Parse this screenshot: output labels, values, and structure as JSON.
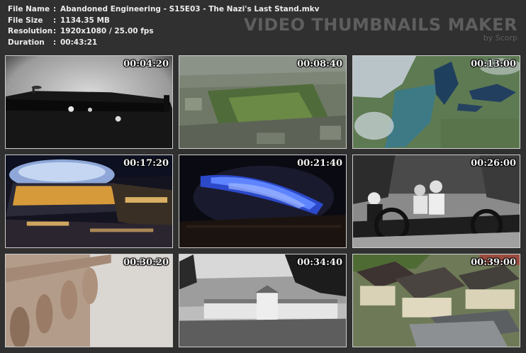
{
  "info": {
    "rows": [
      {
        "key": "File Name",
        "sep": ":",
        "value": "Abandoned Engineering - S15E03 - The Nazi's Last Stand.mkv"
      },
      {
        "key": "File Size",
        "sep": ":",
        "value": "1134.35 MB"
      },
      {
        "key": "Resolution",
        "sep": ":",
        "value": "1920x1080 / 25.00 fps"
      },
      {
        "key": "Duration",
        "sep": ":",
        "value": "00:43:21"
      }
    ]
  },
  "brand": {
    "title": "VIDEO THUMBNAILS MAKER",
    "subtitle": "by Scorp"
  },
  "thumbnails": [
    {
      "timestamp": "00:04:20",
      "scene": "vintage-airplane-bw"
    },
    {
      "timestamp": "00:08:40",
      "scene": "aerial-overgrown-ruins"
    },
    {
      "timestamp": "00:13:00",
      "scene": "satellite-great-lakes"
    },
    {
      "timestamp": "00:17:20",
      "scene": "night-stadium-lights"
    },
    {
      "timestamp": "00:21:40",
      "scene": "blue-lit-dome"
    },
    {
      "timestamp": "00:26:00",
      "scene": "vintage-car-passengers"
    },
    {
      "timestamp": "00:30:20",
      "scene": "blurred-stone-balustrade"
    },
    {
      "timestamp": "00:34:40",
      "scene": "bw-monastery-building"
    },
    {
      "timestamp": "00:39:00",
      "scene": "abandoned-houses-rooftops"
    }
  ],
  "colors": {
    "background": "#303030",
    "info_text": "#ececec",
    "brand_text": "#5e5e5e",
    "thumb_border": "#cfcfcf"
  }
}
